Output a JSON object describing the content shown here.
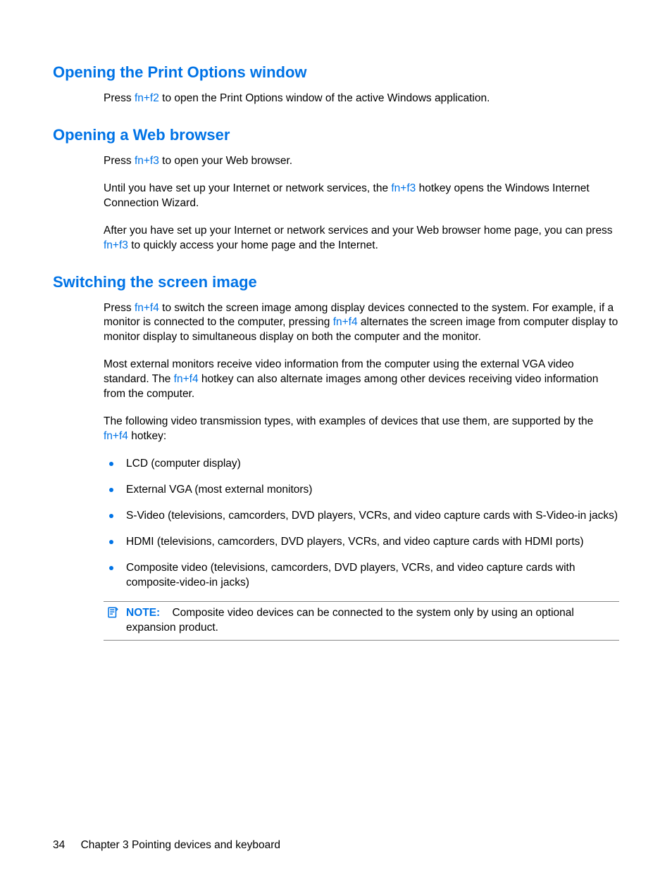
{
  "sections": {
    "printOptions": {
      "heading": "Opening the Print Options window",
      "p1_a": "Press ",
      "p1_hotkey": "fn+f2",
      "p1_b": " to open the Print Options window of the active Windows application."
    },
    "webBrowser": {
      "heading": "Opening a Web browser",
      "p1_a": "Press ",
      "p1_hotkey": "fn+f3",
      "p1_b": " to open your Web browser.",
      "p2_a": "Until you have set up your Internet or network services, the ",
      "p2_hotkey": "fn+f3",
      "p2_b": " hotkey opens the Windows Internet Connection Wizard.",
      "p3_a": "After you have set up your Internet or network services and your Web browser home page, you can press ",
      "p3_hotkey": "fn+f3",
      "p3_b": " to quickly access your home page and the Internet."
    },
    "screenImage": {
      "heading": "Switching the screen image",
      "p1_a": "Press ",
      "p1_hotkey": "fn+f4",
      "p1_b": " to switch the screen image among display devices connected to the system. For example, if a monitor is connected to the computer, pressing ",
      "p1_hotkey2": "fn+f4",
      "p1_c": " alternates the screen image from computer display to monitor display to simultaneous display on both the computer and the monitor.",
      "p2_a": "Most external monitors receive video information from the computer using the external VGA video standard. The ",
      "p2_hotkey": "fn+f4",
      "p2_b": " hotkey can also alternate images among other devices receiving video information from the computer.",
      "p3_a": "The following video transmission types, with examples of devices that use them, are supported by the ",
      "p3_hotkey": "fn+f4",
      "p3_b": " hotkey:",
      "bullets": [
        "LCD (computer display)",
        "External VGA (most external monitors)",
        "S-Video (televisions, camcorders, DVD players, VCRs, and video capture cards with S-Video-in jacks)",
        "HDMI (televisions, camcorders, DVD players, VCRs, and video capture cards with HDMI ports)",
        "Composite video (televisions, camcorders, DVD players, VCRs, and video capture cards with composite-video-in jacks)"
      ],
      "note_label": "NOTE:",
      "note_text": "Composite video devices can be connected to the system only by using an optional expansion product."
    }
  },
  "footer": {
    "page": "34",
    "chapter": "Chapter 3   Pointing devices and keyboard"
  }
}
